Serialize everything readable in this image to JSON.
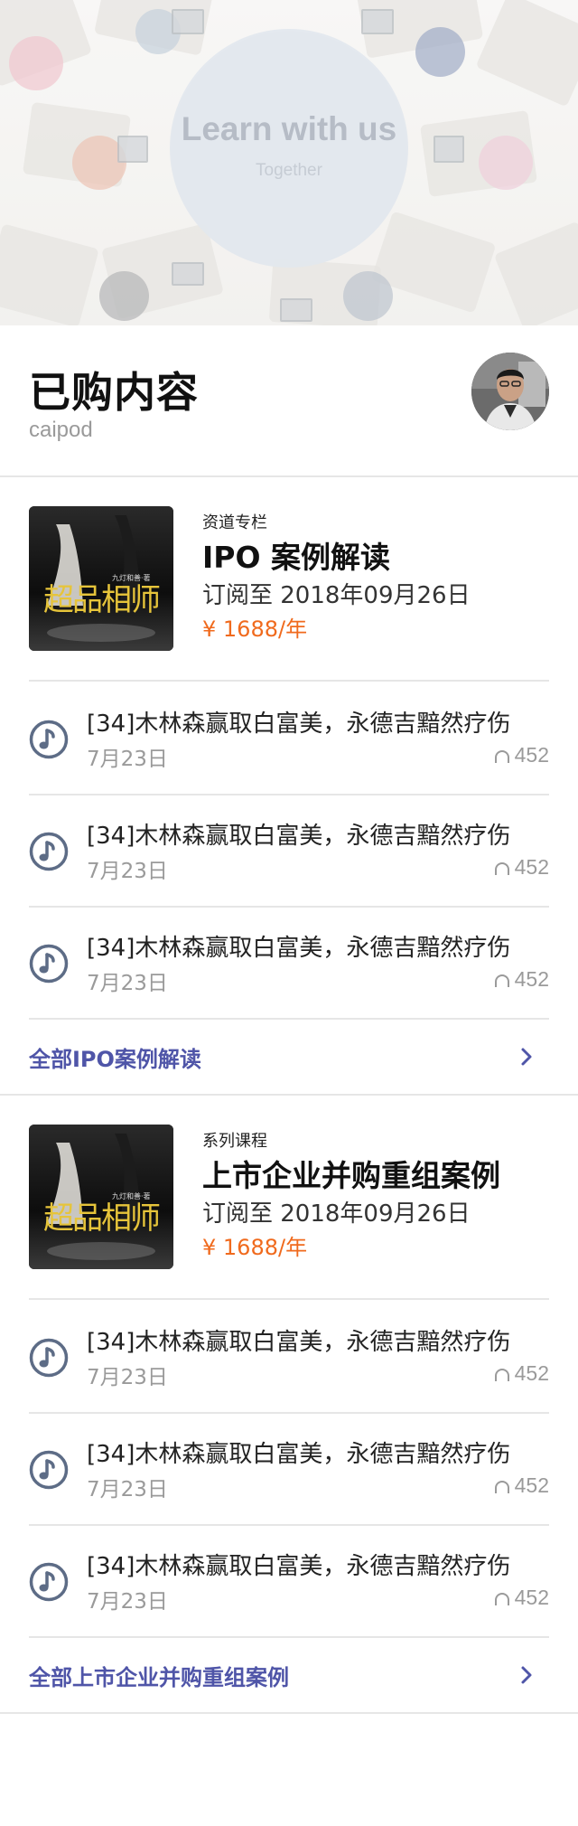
{
  "hero": {
    "title": "Learn with us",
    "subtitle": "Together"
  },
  "header": {
    "title": "已购内容",
    "username": "caipod"
  },
  "sections": [
    {
      "type": "资道专栏",
      "title": "IPO 案例解读",
      "subscription": "订阅至 2018年09月26日",
      "price": "¥ 1688/年",
      "cover_text": "超品相师",
      "cover_small": "九灯和善·著",
      "episodes": [
        {
          "title": "[34]木林森赢取白富美，永德吉黯然疗伤",
          "date": "7月23日",
          "plays": "452"
        },
        {
          "title": "[34]木林森赢取白富美，永德吉黯然疗伤",
          "date": "7月23日",
          "plays": "452"
        },
        {
          "title": "[34]木林森赢取白富美，永德吉黯然疗伤",
          "date": "7月23日",
          "plays": "452"
        }
      ],
      "all_link": "全部IPO案例解读"
    },
    {
      "type": "系列课程",
      "title": "上市企业并购重组案例",
      "subscription": "订阅至 2018年09月26日",
      "price": "¥ 1688/年",
      "cover_text": "超品相师",
      "cover_small": "九灯和善·著",
      "episodes": [
        {
          "title": "[34]木林森赢取白富美，永德吉黯然疗伤",
          "date": "7月23日",
          "plays": "452"
        },
        {
          "title": "[34]木林森赢取白富美，永德吉黯然疗伤",
          "date": "7月23日",
          "plays": "452"
        },
        {
          "title": "[34]木林森赢取白富美，永德吉黯然疗伤",
          "date": "7月23日",
          "plays": "452"
        }
      ],
      "all_link": "全部上市企业并购重组案例"
    }
  ],
  "icons": {
    "episode": "music-note-icon",
    "plays": "headphones-icon",
    "all_link": "chevron-right-icon"
  },
  "colors": {
    "accent": "#4f55a8",
    "price": "#f06a1d",
    "icon": "#5d6c86"
  }
}
